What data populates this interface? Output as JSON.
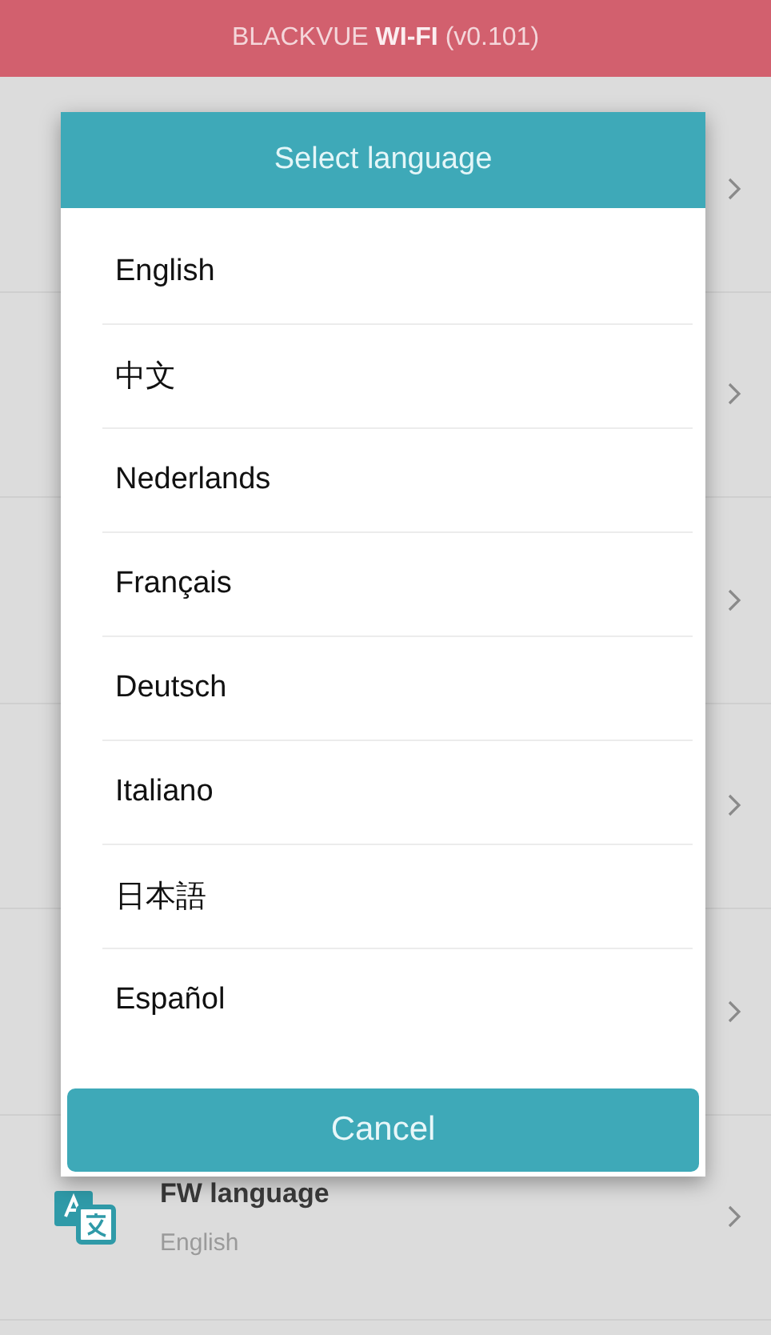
{
  "header": {
    "title": "BLACKVUE **WI-FI** (v0.101)"
  },
  "settings_rows": [
    {
      "title": "FW language",
      "value": "English"
    }
  ],
  "dialog": {
    "title": "Select language",
    "options": [
      {
        "label": "English"
      },
      {
        "label": "中文"
      },
      {
        "label": "Nederlands"
      },
      {
        "label": "Français"
      },
      {
        "label": "Deutsch"
      },
      {
        "label": "Italiano"
      },
      {
        "label": "日本語"
      },
      {
        "label": "Español"
      }
    ],
    "cancel": "Cancel"
  }
}
